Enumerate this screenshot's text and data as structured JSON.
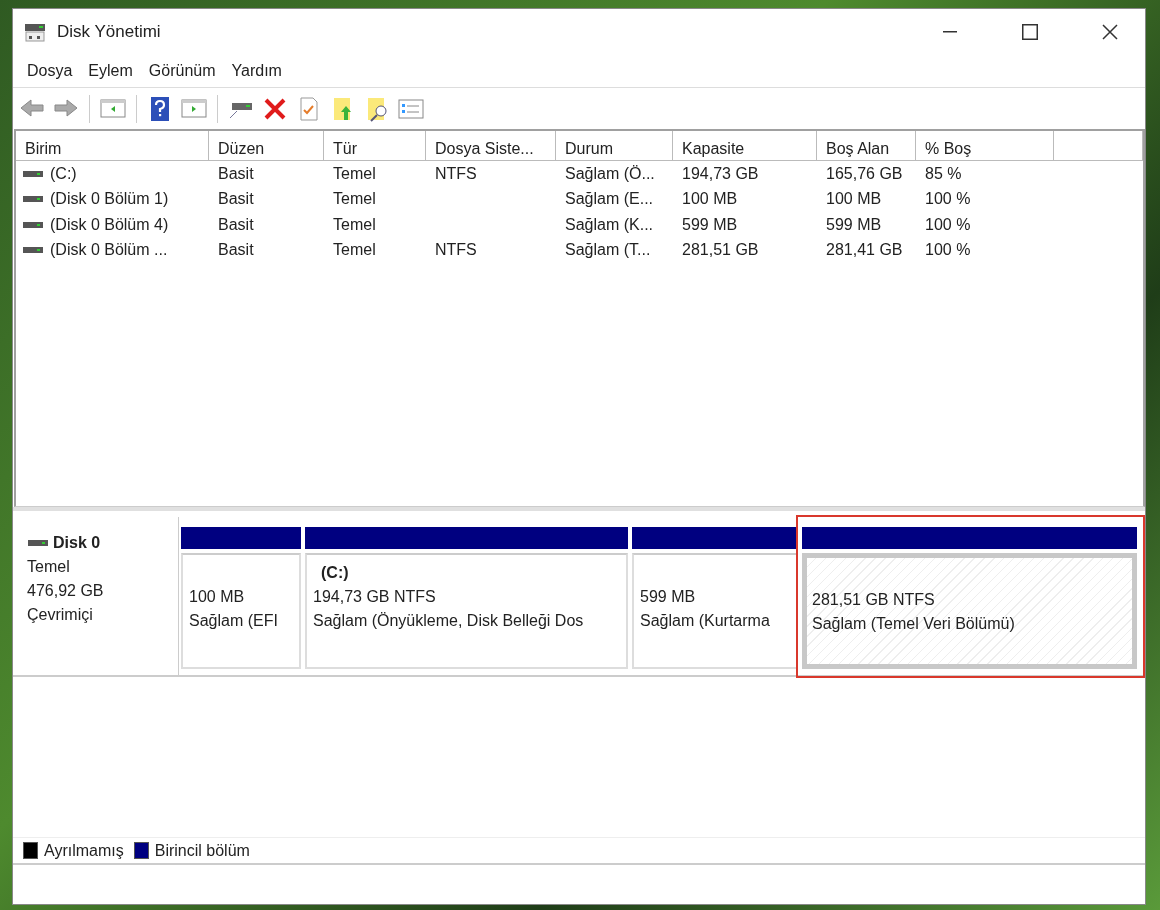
{
  "window": {
    "title": "Disk Yönetimi"
  },
  "menu": [
    "Dosya",
    "Eylem",
    "Görünüm",
    "Yardım"
  ],
  "volume_table": {
    "columns": [
      "Birim",
      "Düzen",
      "Tür",
      "Dosya Siste...",
      "Durum",
      "Kapasite",
      "Boş Alan",
      "% Boş"
    ],
    "rows": [
      {
        "cells": [
          "(C:)",
          "Basit",
          "Temel",
          "NTFS",
          "Sağlam (Ö...",
          "194,73 GB",
          "165,76 GB",
          "85 %"
        ]
      },
      {
        "cells": [
          "(Disk 0 Bölüm 1)",
          "Basit",
          "Temel",
          "",
          "Sağlam (E...",
          "100 MB",
          "100 MB",
          "100 %"
        ]
      },
      {
        "cells": [
          "(Disk 0 Bölüm 4)",
          "Basit",
          "Temel",
          "",
          "Sağlam (K...",
          "599 MB",
          "599 MB",
          "100 %"
        ]
      },
      {
        "cells": [
          "(Disk 0 Bölüm ...",
          "Basit",
          "Temel",
          "NTFS",
          "Sağlam (T...",
          "281,51 GB",
          "281,41 GB",
          "100 %"
        ]
      }
    ]
  },
  "disks": [
    {
      "name": "Disk 0",
      "type": "Temel",
      "size": "476,92 GB",
      "status": "Çevrimiçi",
      "partitions": [
        {
          "size": "100 MB",
          "status": "Sağlam (EFI",
          "selected": false,
          "highlighted": false
        },
        {
          "label": "(C:)",
          "size": "194,73 GB NTFS",
          "status": "Sağlam (Önyükleme, Disk Belleği Dos",
          "selected": false,
          "highlighted": false
        },
        {
          "size": "599 MB",
          "status": "Sağlam (Kurtarma",
          "selected": false,
          "highlighted": false
        },
        {
          "size": "281,51 GB NTFS",
          "status": "Sağlam (Temel Veri Bölümü)",
          "selected": true,
          "highlighted": true
        }
      ]
    }
  ],
  "legend": [
    {
      "label": "Ayrılmamış",
      "color": "#000000"
    },
    {
      "label": "Birincil bölüm",
      "color": "#000080"
    }
  ]
}
